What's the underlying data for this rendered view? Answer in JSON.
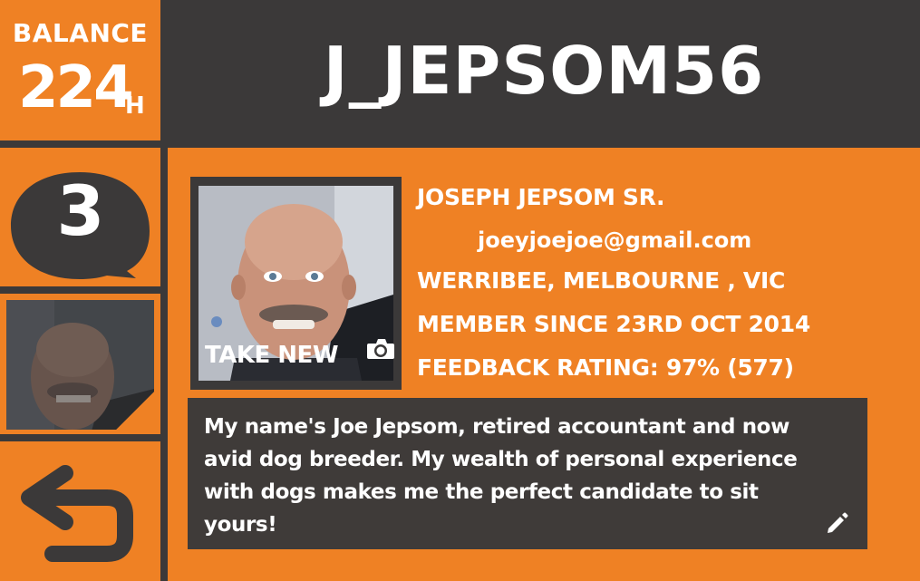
{
  "balance": {
    "label": "BALANCE",
    "value": "224",
    "unit": "H"
  },
  "messages": {
    "count": "3"
  },
  "profile": {
    "username": "J_JEPSOM56",
    "full_name": "JOSEPH JEPSOM SR.",
    "email": "joeyjoejoe@gmail.com",
    "location": "WERRIBEE, MELBOURNE , VIC",
    "member_since": "MEMBER SINCE 23RD OCT 2014",
    "feedback": "FEEDBACK RATING: 97% (577)",
    "bio": "My name's Joe Jepsom, retired accountant and now avid dog breeder. My wealth of personal experience with dogs makes me the perfect candidate to sit yours!",
    "take_new_label": "TAKE NEW"
  },
  "icons": {
    "messages": "speech-bubble-icon",
    "back": "back-arrow-icon",
    "camera": "camera-icon",
    "edit": "pencil-icon"
  },
  "colors": {
    "accent": "#ef8124",
    "dark": "#3b3939",
    "text": "#ffffff"
  }
}
